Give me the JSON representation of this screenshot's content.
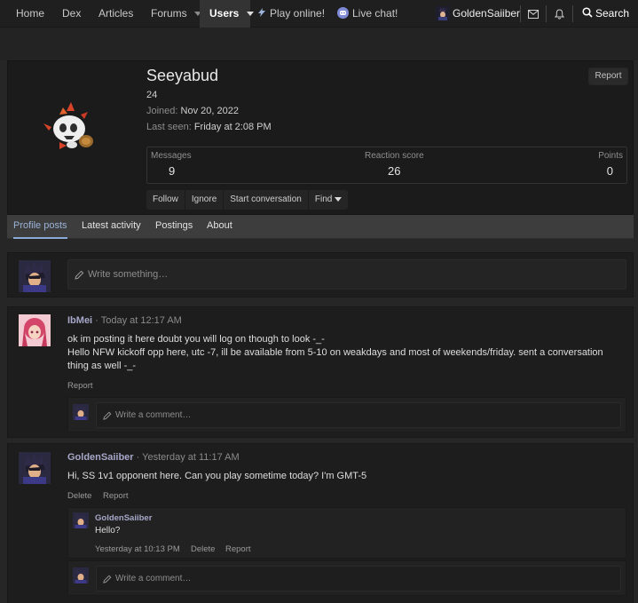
{
  "nav": {
    "home": "Home",
    "dex": "Dex",
    "articles": "Articles",
    "forums": "Forums",
    "users": "Users",
    "play": "Play online!",
    "chat": "Live chat!",
    "account": "GoldenSaiiber",
    "search": "Search"
  },
  "profile": {
    "name": "Seeyabud",
    "age": "24",
    "joined_label": "Joined:",
    "joined": "Nov 20, 2022",
    "lastseen_label": "Last seen:",
    "lastseen": "Friday at 2:08 PM",
    "report": "Report",
    "stats": {
      "messages_label": "Messages",
      "messages": "9",
      "reaction_label": "Reaction score",
      "reaction": "26",
      "points_label": "Points",
      "points": "0"
    },
    "buttons": {
      "follow": "Follow",
      "ignore": "Ignore",
      "conversation": "Start conversation",
      "find": "Find"
    }
  },
  "tabs": {
    "profile_posts": "Profile posts",
    "latest_activity": "Latest activity",
    "postings": "Postings",
    "about": "About"
  },
  "composer": {
    "placeholder": "Write something…"
  },
  "posts": [
    {
      "user": "IbMei",
      "time": "Today at 12:17 AM",
      "line1": "ok im posting it here doubt you will log on though to look -_-",
      "line2": "Hello NFW kickoff opp here, utc -7, ill be available from 5-10 on weakdays and most of weekends/friday. sent a conversation",
      "line3": "thing as well -_-",
      "report": "Report",
      "comment_placeholder": "Write a comment…"
    },
    {
      "user": "GoldenSaiiber",
      "time": "Yesterday at 11:17 AM",
      "text": "Hi, SS 1v1 opponent here. Can you play sometime today? I'm GMT-5",
      "delete": "Delete",
      "report": "Report",
      "reply": {
        "user": "GoldenSaiiber",
        "text": "Hello?",
        "time": "Yesterday at 10:13 PM",
        "delete": "Delete",
        "report": "Report"
      },
      "comment_placeholder": "Write a comment…"
    }
  ],
  "separator": "·",
  "colors": {
    "accent": "#8aa9d6",
    "username": "#a7a7c9",
    "background": "#262626"
  },
  "icons": [
    "play-bolt-icon",
    "discord-icon",
    "mail-icon",
    "bell-icon",
    "search-icon",
    "pencil-icon",
    "chevron-down-icon"
  ]
}
